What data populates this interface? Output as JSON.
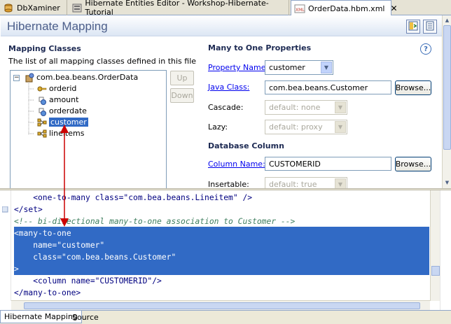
{
  "tabs": [
    {
      "label": "DbXaminer",
      "active": false,
      "icon": "database-icon"
    },
    {
      "label": "Hibernate Entities Editor - Workshop-Hibernate-Tutorial",
      "active": false,
      "icon": "entities-editor-icon"
    },
    {
      "label": "OrderData.hbm.xml",
      "active": true,
      "icon": "xml-file-icon"
    }
  ],
  "header": {
    "title": "Hibernate Mapping"
  },
  "mapping_classes": {
    "title": "Mapping Classes",
    "description": "The list of all mapping classes defined in this file",
    "root": "com.bea.beans.OrderData",
    "expander": "−",
    "items": [
      {
        "label": "orderid",
        "icon": "key-property-icon"
      },
      {
        "label": "amount",
        "icon": "property-icon"
      },
      {
        "label": "orderdate",
        "icon": "property-icon"
      },
      {
        "label": "customer",
        "icon": "many-to-one-icon",
        "selected": true
      },
      {
        "label": "lineitems",
        "icon": "one-to-many-icon"
      }
    ],
    "up_label": "Up",
    "down_label": "Down"
  },
  "many_to_one": {
    "title": "Many to One Properties",
    "property_name_label": "Property Name:",
    "property_name_value": "customer",
    "java_class_label": "Java Class:",
    "java_class_value": "com.bea.beans.Customer",
    "browse_label": "Browse...",
    "cascade_label": "Cascade:",
    "cascade_value": "default: none",
    "lazy_label": "Lazy:",
    "lazy_value": "default: proxy"
  },
  "database_column": {
    "title": "Database Column",
    "column_name_label": "Column Name:",
    "column_name_value": "CUSTOMERID",
    "browse_label": "Browse...",
    "insertable_label": "Insertable:",
    "insertable_value": "default: true"
  },
  "help_glyph": "?",
  "source": {
    "lines": [
      {
        "text": "    <one-to-many class=\"com.bea.beans.Lineitem\" />",
        "type": "code"
      },
      {
        "text": "</set>",
        "type": "code"
      },
      {
        "text": "<!-- bi-directional many-to-one association to Customer -->",
        "type": "comment"
      },
      {
        "text": "<many-to-one",
        "type": "selected"
      },
      {
        "text": "    name=\"customer\"",
        "type": "selected"
      },
      {
        "text": "    class=\"com.bea.beans.Customer\"",
        "type": "selected"
      },
      {
        "text": ">",
        "type": "selected"
      },
      {
        "text": "    <column name=\"CUSTOMERID\"/>",
        "type": "code"
      },
      {
        "text": "</many-to-one>",
        "type": "code"
      }
    ]
  },
  "bottom_tabs": [
    {
      "label": "Hibernate Mapping",
      "active": true
    },
    {
      "label": "Source",
      "active": false
    }
  ],
  "colors": {
    "selection": "#316ac5",
    "link": "#0000ee",
    "comment": "#3f7f5f",
    "annotation_arrow": "#cc0000"
  }
}
